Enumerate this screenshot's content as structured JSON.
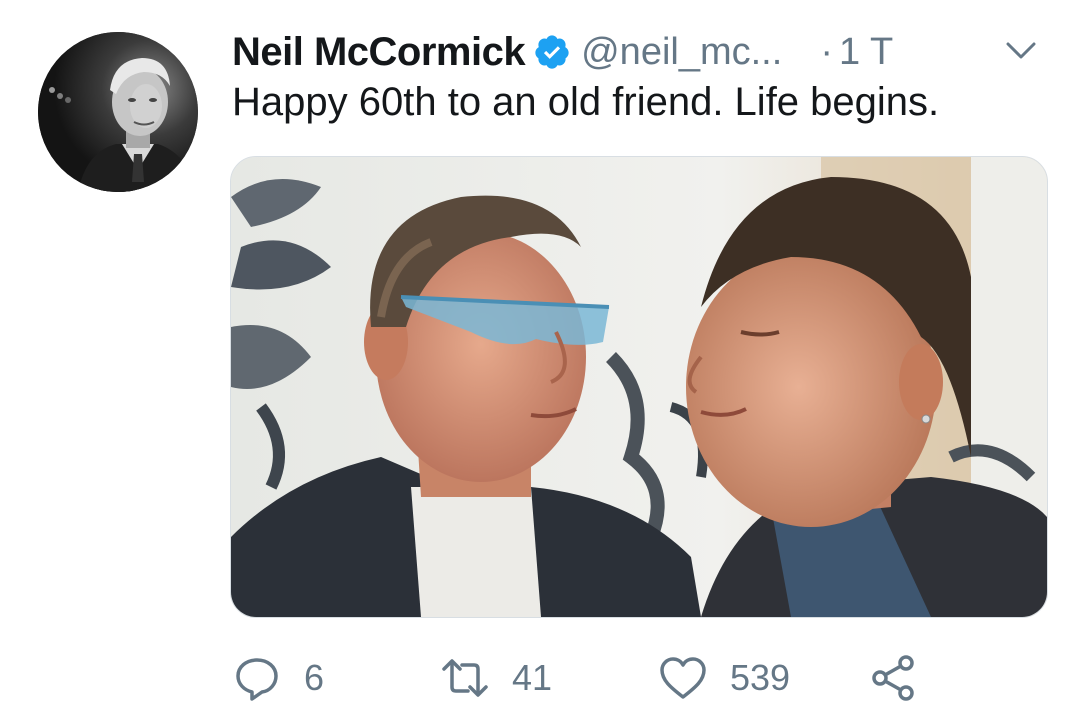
{
  "tweet": {
    "display_name": "Neil McCormick",
    "handle": "@neil_mc...",
    "separator": "·",
    "time": "1 T",
    "text": "Happy 60th to an old friend. Life begins.",
    "media_description_icon": "photo-icon"
  },
  "actions": {
    "reply_count": "6",
    "retweet_count": "41",
    "like_count": "539"
  },
  "colors": {
    "verified_blue": "#1da1f2",
    "secondary_text": "#657786",
    "primary_text": "#14171a",
    "icon_gray": "#657786"
  },
  "icons": {
    "verified": "verified-badge-icon",
    "chevron": "chevron-down-icon",
    "reply": "reply-icon",
    "retweet": "retweet-icon",
    "like": "heart-icon",
    "share": "share-icon"
  }
}
